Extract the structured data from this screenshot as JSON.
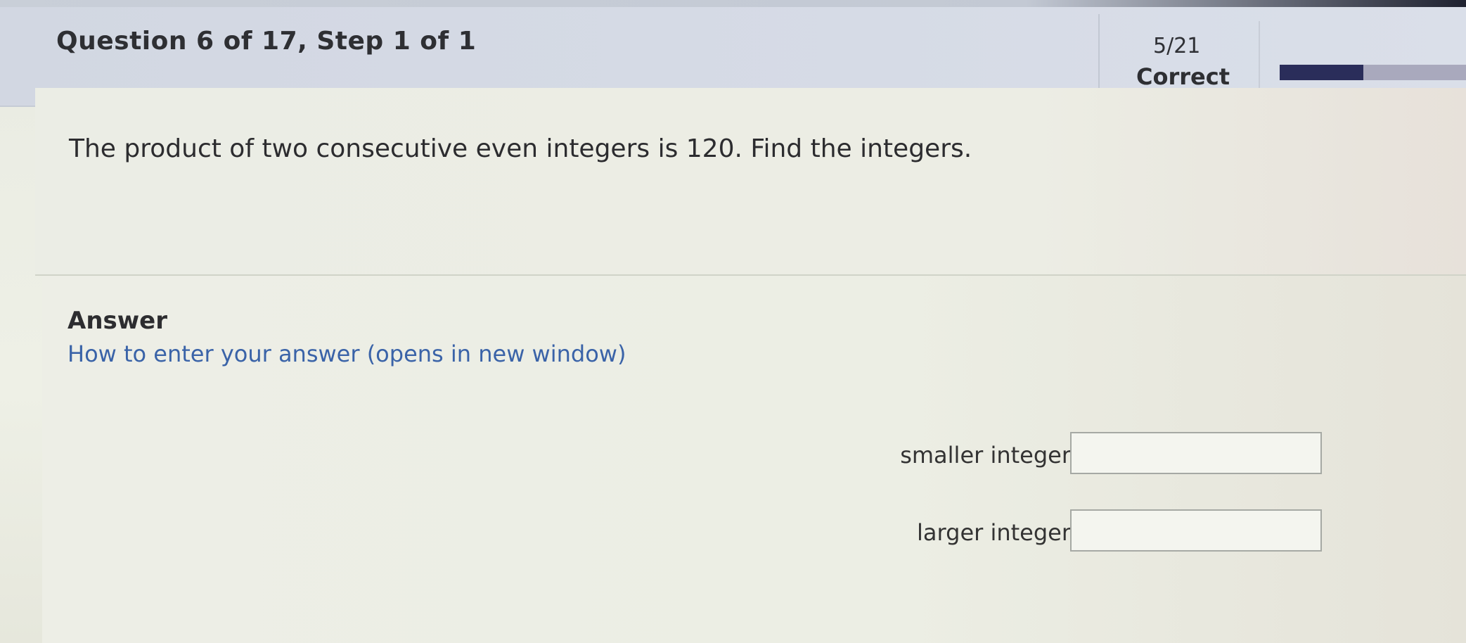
{
  "header": {
    "question_title": "Question 6 of 17,  Step 1 of 1",
    "score": "5/21",
    "status": "Correct",
    "progress_fraction": 0.45
  },
  "question": {
    "prompt": "The product of two consecutive even integers is 120.  Find the integers."
  },
  "answer": {
    "heading": "Answer",
    "help_link": "How to enter your answer (opens in new window)",
    "fields": [
      {
        "label": "smaller integer =",
        "value": ""
      },
      {
        "label": "larger integer =",
        "value": ""
      }
    ]
  },
  "colors": {
    "header_bg": "#d4d9e4",
    "progress_fill": "#2a2d5a",
    "link": "#3a63a8"
  }
}
